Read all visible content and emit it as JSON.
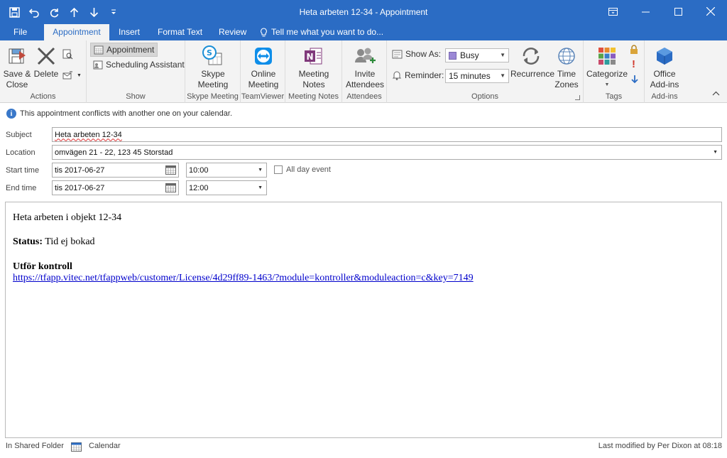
{
  "window": {
    "title": "Heta arbeten 12-34 - Appointment",
    "controls": [
      "restore-ribbon",
      "minimize",
      "maximize",
      "close"
    ]
  },
  "quick_access": [
    "save",
    "undo",
    "redo",
    "previous-item",
    "next-item",
    "customize"
  ],
  "tabs": {
    "file": "File",
    "appointment": "Appointment",
    "insert": "Insert",
    "format_text": "Format Text",
    "review": "Review",
    "tell_me": "Tell me what you want to do..."
  },
  "ribbon": {
    "actions": {
      "save_close_line1": "Save &",
      "save_close_line2": "Close",
      "delete": "Delete",
      "label": "Actions"
    },
    "show": {
      "appointment": "Appointment",
      "scheduling": "Scheduling Assistant",
      "label": "Show"
    },
    "skype": {
      "line1": "Skype",
      "line2": "Meeting",
      "label": "Skype Meeting"
    },
    "teamviewer": {
      "line1": "Online",
      "line2": "Meeting",
      "label": "TeamViewer"
    },
    "meeting_notes": {
      "line1": "Meeting",
      "line2": "Notes",
      "label": "Meeting Notes"
    },
    "attendees": {
      "line1": "Invite",
      "line2": "Attendees",
      "label": "Attendees"
    },
    "options": {
      "show_as_label": "Show As:",
      "show_as_value": "Busy",
      "show_as_color": "#9b88d6",
      "reminder_label": "Reminder:",
      "reminder_value": "15 minutes",
      "recurrence": "Recurrence",
      "time_zones_line1": "Time",
      "time_zones_line2": "Zones",
      "label": "Options"
    },
    "tags": {
      "categorize": "Categorize",
      "label": "Tags"
    },
    "addins": {
      "line1": "Office",
      "line2": "Add-ins",
      "label": "Add-ins"
    }
  },
  "info": {
    "message": "This appointment conflicts with another one on your calendar."
  },
  "form": {
    "subject_label": "Subject",
    "subject_value": "Heta arbeten 12-34",
    "location_label": "Location",
    "location_value": "omvägen 21 - 22, 123 45 Storstad",
    "start_label": "Start time",
    "start_date": "tis 2017-06-27",
    "start_time": "10:00",
    "all_day_label": "All day event",
    "end_label": "End time",
    "end_date": "tis 2017-06-27",
    "end_time": "12:00"
  },
  "body": {
    "line1": "Heta arbeten i objekt 12-34",
    "status_label": "Status:",
    "status_value": " Tid ej bokad",
    "kontroll_label": "Utför kontroll",
    "link": "https://tfapp.vitec.net/tfappweb/customer/License/4d29ff89-1463/?module=kontroller&moduleaction=c&key=7149"
  },
  "status_bar": {
    "left": "In Shared Folder",
    "calendar": "Calendar",
    "right": "Last modified by Per Dixon at 08:18"
  }
}
